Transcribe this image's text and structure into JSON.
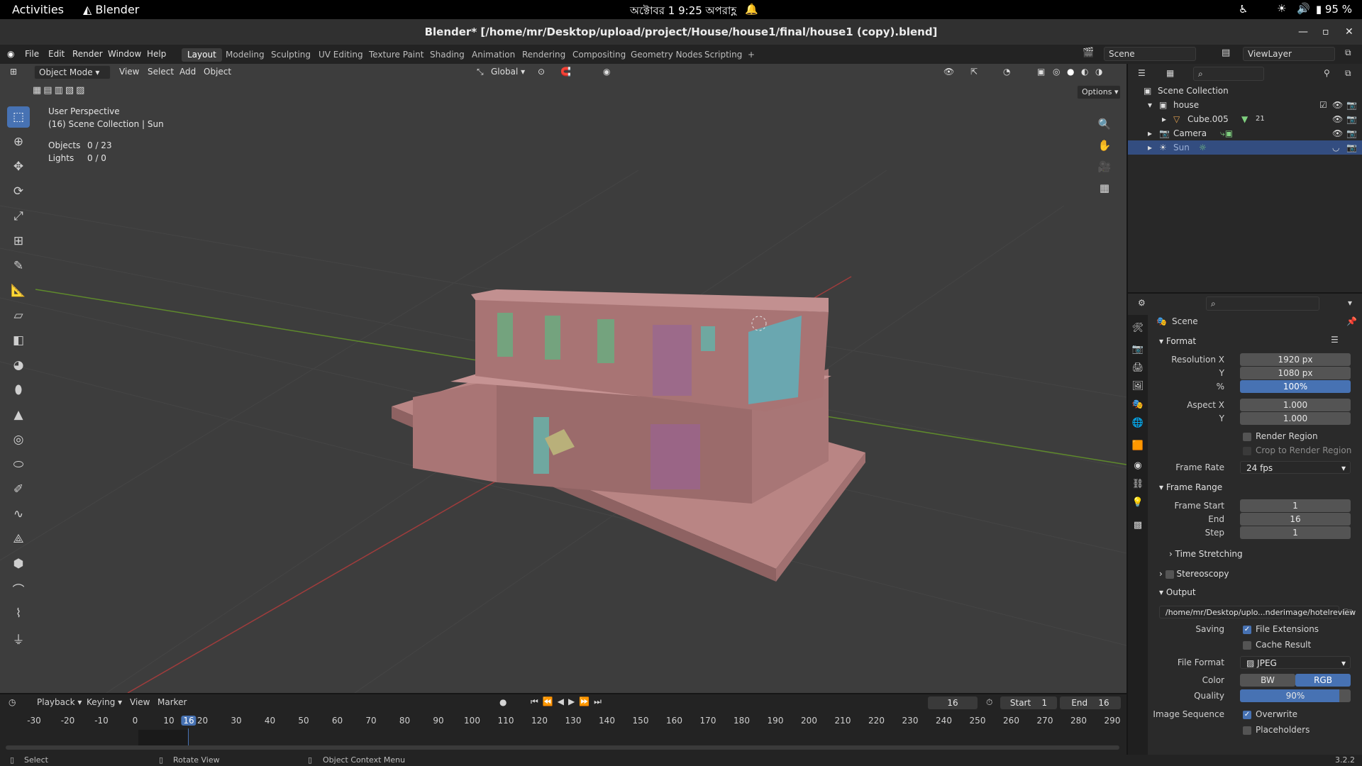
{
  "gnome": {
    "activities": "Activities",
    "app": "Blender",
    "clock": "অক্টোবর 1  9:25 অপরাহ্ণ",
    "battery": "95 %"
  },
  "window": {
    "title": "Blender* [/home/mr/Desktop/upload/project/House/house1/final/house1 (copy).blend]"
  },
  "menu": [
    "File",
    "Edit",
    "Render",
    "Window",
    "Help"
  ],
  "workspaces": [
    "Layout",
    "Modeling",
    "Sculpting",
    "UV Editing",
    "Texture Paint",
    "Shading",
    "Animation",
    "Rendering",
    "Compositing",
    "Geometry Nodes",
    "Scripting",
    "+"
  ],
  "scene_field": "Scene",
  "viewlayer_field": "ViewLayer",
  "viewport": {
    "mode": "Object Mode",
    "menus": [
      "View",
      "Select",
      "Add",
      "Object"
    ],
    "orientation": "Global",
    "options": "Options",
    "perspective": "User Perspective",
    "collection": "(16) Scene Collection | Sun",
    "stats": [
      {
        "label": "Objects",
        "value": "0 / 23"
      },
      {
        "label": "Lights",
        "value": "0 / 0"
      }
    ]
  },
  "outliner": {
    "root": "Scene Collection",
    "items": [
      {
        "name": "house",
        "indent": 1
      },
      {
        "name": "Cube.005",
        "indent": 2,
        "extra": "21"
      },
      {
        "name": "Camera",
        "indent": 1
      },
      {
        "name": "Sun",
        "indent": 1
      }
    ]
  },
  "properties": {
    "context": "Scene",
    "format": {
      "title": "Format",
      "res_x_label": "Resolution X",
      "res_x": "1920 px",
      "res_y_label": "Y",
      "res_y": "1080 px",
      "pct_label": "%",
      "pct": "100%",
      "aspect_x_label": "Aspect X",
      "aspect_x": "1.000",
      "aspect_y_label": "Y",
      "aspect_y": "1.000",
      "render_region": "Render Region",
      "crop": "Crop to Render Region",
      "frame_rate_label": "Frame Rate",
      "frame_rate": "24 fps"
    },
    "frame_range": {
      "title": "Frame Range",
      "start_label": "Frame Start",
      "start": "1",
      "end_label": "End",
      "end": "16",
      "step_label": "Step",
      "step": "1"
    },
    "time_stretching": "Time Stretching",
    "stereoscopy": "Stereoscopy",
    "output": {
      "title": "Output",
      "path": "/home/mr/Desktop/uplo...nderimage/hotelreview",
      "saving_label": "Saving",
      "file_ext": "File Extensions",
      "cache": "Cache Result",
      "file_format_label": "File Format",
      "file_format": "JPEG",
      "color_label": "Color",
      "bw": "BW",
      "rgb": "RGB",
      "quality_label": "Quality",
      "quality": "90%",
      "image_seq_label": "Image Sequence",
      "overwrite": "Overwrite",
      "placeholders": "Placeholders"
    }
  },
  "timeline": {
    "menus": [
      "Playback",
      "Keying",
      "View",
      "Marker"
    ],
    "current": "16",
    "start_label": "Start",
    "start": "1",
    "end_label": "End",
    "end": "16",
    "ticks": [
      "-30",
      "-20",
      "-10",
      "0",
      "10",
      "20",
      "30",
      "40",
      "50",
      "60",
      "70",
      "80",
      "90",
      "100",
      "110",
      "120",
      "130",
      "140",
      "150",
      "160",
      "170",
      "180",
      "190",
      "200",
      "210",
      "220",
      "230",
      "240",
      "250",
      "260",
      "270",
      "280",
      "290"
    ]
  },
  "status": {
    "select": "Select",
    "rotate": "Rotate View",
    "context": "Object Context Menu",
    "version": "3.2.2"
  }
}
